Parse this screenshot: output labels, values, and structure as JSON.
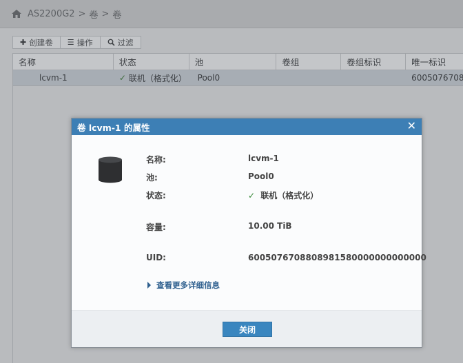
{
  "breadcrumb": {
    "items": [
      "AS2200G2",
      "卷",
      "卷"
    ],
    "separator": ">"
  },
  "toolbar": {
    "create_label": "创建卷",
    "actions_label": "操作",
    "filter_label": "过滤"
  },
  "table": {
    "columns": [
      "名称",
      "状态",
      "池",
      "卷组",
      "卷组标识",
      "唯一标识"
    ],
    "rows": [
      {
        "name": "lcvm-1",
        "status": "联机（格式化）",
        "pool": "Pool0",
        "volume_group": "",
        "volume_group_id": "",
        "uid": "60050767088"
      }
    ]
  },
  "dialog": {
    "title": "卷 lcvm-1 的属性",
    "props": [
      {
        "label": "名称:",
        "value": "lcvm-1"
      },
      {
        "label": "池:",
        "value": "Pool0"
      },
      {
        "label": "状态:",
        "value": "联机（格式化）"
      },
      {
        "label": "容量:",
        "value": "10.00 TiB"
      },
      {
        "label": "UID:",
        "value": "6005076708808981580000000000000"
      }
    ],
    "more_link": "查看更多详细信息",
    "close_label": "关闭"
  },
  "colors": {
    "dialog_title_bg": "#3d7fb5",
    "button_bg": "#3a86bf",
    "status_ok": "#3a8a3a"
  }
}
